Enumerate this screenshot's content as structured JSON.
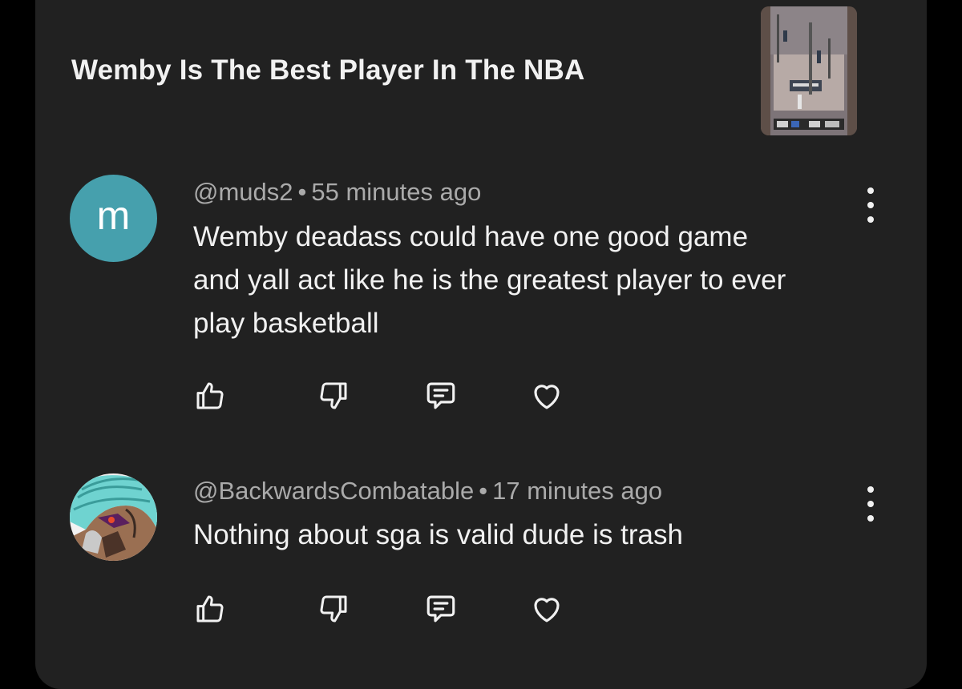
{
  "video": {
    "title": "Wemby Is The Best Player In The NBA"
  },
  "comments": [
    {
      "avatar_letter": "m",
      "avatar_color": "#46a0ad",
      "handle": "@muds2",
      "separator": "•",
      "time": "55 minutes ago",
      "text": "Wemby deadass could have one good game\nand yall act like he is the greatest player to ever\nplay basketball"
    },
    {
      "avatar_image": "anime-character-avatar",
      "handle": "@BackwardsCombatable",
      "separator": "•",
      "time": "17 minutes ago",
      "text": "Nothing about sga is valid dude is trash"
    }
  ],
  "icons": {
    "like": "thumbs-up-icon",
    "dislike": "thumbs-down-icon",
    "reply": "reply-icon",
    "heart": "heart-icon",
    "menu": "more-vertical-icon"
  },
  "colors": {
    "panel_bg": "#212121",
    "page_bg": "#000000",
    "primary_text": "#f1f1f1",
    "secondary_text": "#aaaaaa"
  }
}
